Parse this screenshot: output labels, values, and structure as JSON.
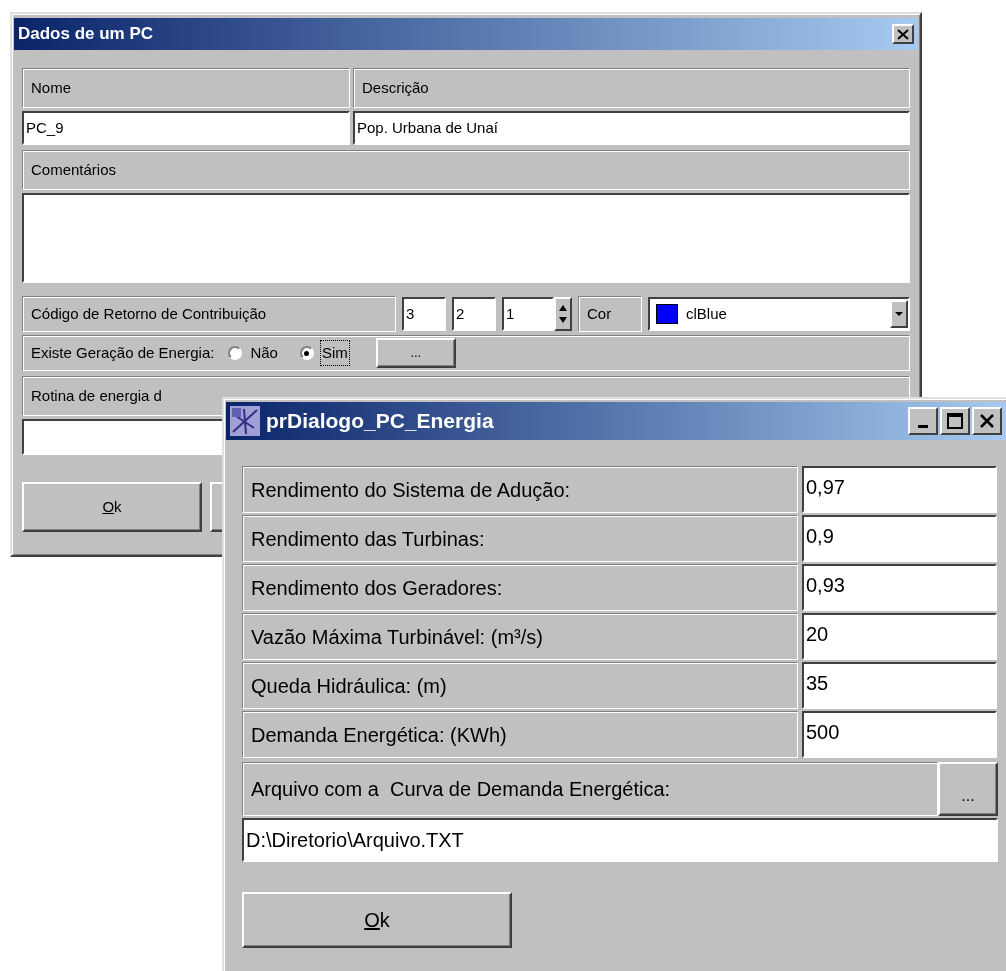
{
  "main_dialog": {
    "title": "Dados de um PC",
    "name_label": "Nome",
    "name_value": "PC_9",
    "description_label": "Descrição",
    "description_value": "Pop. Urbana de Unaí",
    "comments_label": "Comentários",
    "return_code": {
      "label": "Código de Retorno de Contribuição",
      "values": [
        "3",
        "2",
        "1"
      ]
    },
    "color": {
      "label": "Cor",
      "value": "clBlue",
      "color": "#0000ff"
    },
    "energy_generation": {
      "label": "Existe Geração de Energia:",
      "options": [
        {
          "label": "Não",
          "selected": false
        },
        {
          "label": "Sim",
          "selected": true
        }
      ],
      "button": "..."
    },
    "routine_label": "Rotina de energia d",
    "ok_button": {
      "label": "Ok"
    }
  },
  "energy_dialog": {
    "title": "prDialogo_PC_Energia",
    "parameters": [
      {
        "label": "Rendimento do Sistema de Adução:",
        "value": "0,97"
      },
      {
        "label": "Rendimento das Turbinas:",
        "value": "0,9"
      },
      {
        "label": "Rendimento dos Geradores:",
        "value": "0,93"
      },
      {
        "label": "Vazão Máxima Turbinável: (m³/s)",
        "value": "20"
      },
      {
        "label": "Queda Hidráulica: (m)",
        "value": "35"
      },
      {
        "label": "Demanda Energética: (KWh)",
        "value": "500"
      }
    ],
    "file_label": "Arquivo com a  Curva de Demanda Energética:",
    "browse_button": "...",
    "file_value": "D:\\Diretorio\\Arquivo.TXT",
    "ok_button": {
      "label": "Ok"
    }
  }
}
